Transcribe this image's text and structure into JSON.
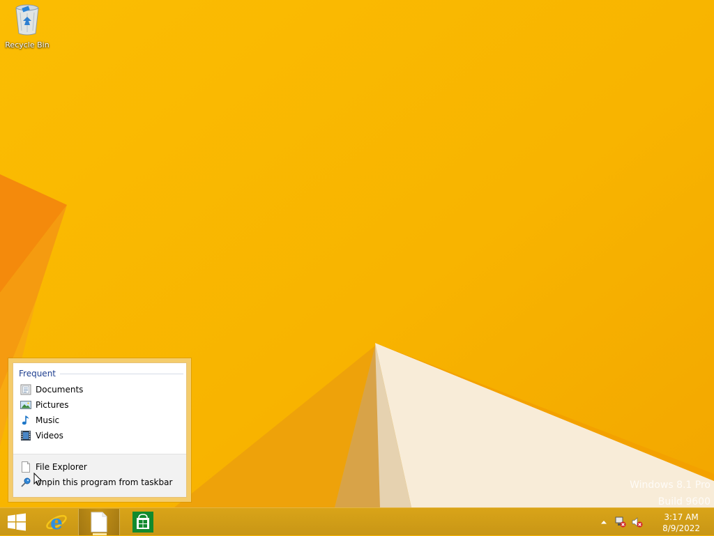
{
  "desktop": {
    "icons": [
      {
        "label": "Recycle Bin",
        "icon": "recycle-bin-icon"
      }
    ]
  },
  "jumplist": {
    "heading": "Frequent",
    "items": [
      {
        "label": "Documents",
        "icon": "documents-library-icon"
      },
      {
        "label": "Pictures",
        "icon": "pictures-library-icon"
      },
      {
        "label": "Music",
        "icon": "music-library-icon"
      },
      {
        "label": "Videos",
        "icon": "videos-library-icon"
      }
    ],
    "tasks": [
      {
        "label": "File Explorer",
        "icon": "file-explorer-icon"
      },
      {
        "label": "Unpin this program from taskbar",
        "icon": "unpin-icon"
      }
    ]
  },
  "watermark": {
    "line1": "Windows 8.1 Pro",
    "line2": "Build 9600"
  },
  "taskbar": {
    "buttons": [
      {
        "name": "start",
        "icon": "windows-logo-icon"
      },
      {
        "name": "internet-explorer",
        "icon": "internet-explorer-icon"
      },
      {
        "name": "file-explorer",
        "icon": "file-explorer-icon",
        "active": true
      },
      {
        "name": "store",
        "icon": "store-icon"
      }
    ],
    "tray": {
      "icons": [
        "show-hidden-icons-chevron-icon",
        "network-disconnected-icon",
        "speaker-muted-icon"
      ],
      "time": "3:17 AM",
      "date": "8/9/2022"
    }
  },
  "colors": {
    "wallpaper": "#f7b500",
    "taskbar": "#cf9c17",
    "jumplist_frame": "#f4cc6c",
    "jumplist_heading": "#1e3e8f"
  }
}
